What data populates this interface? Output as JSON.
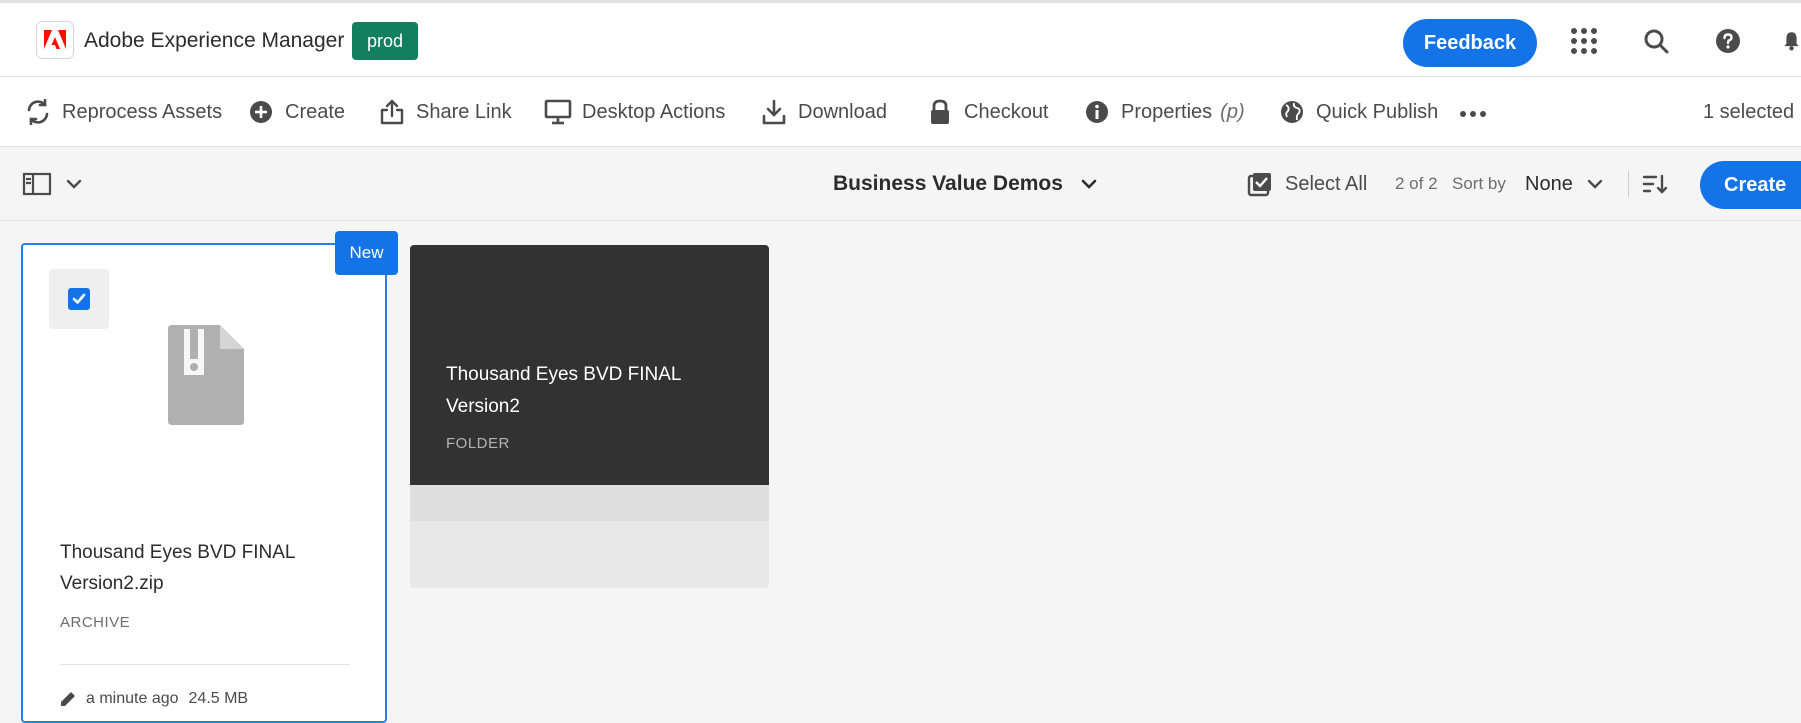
{
  "header": {
    "app_title": "Adobe Experience Manager",
    "env_badge": "prod",
    "feedback_label": "Feedback",
    "icons": [
      "adobe-logo-icon",
      "apps-grid-icon",
      "search-icon",
      "help-icon",
      "bell-icon"
    ],
    "brand_color": "#fa0f00",
    "env_color": "#12805c",
    "accent_color": "#1473e6"
  },
  "actions": {
    "reprocess": "Reprocess Assets",
    "create": "Create",
    "share_link": "Share Link",
    "desktop_actions": "Desktop Actions",
    "download": "Download",
    "checkout": "Checkout",
    "properties": "Properties",
    "properties_shortcut": "(p)",
    "quick_publish": "Quick Publish",
    "selected_count": "1 selected ("
  },
  "context": {
    "folder_title": "Business Value Demos",
    "select_all": "Select All",
    "count": "2 of 2",
    "sort_by_label": "Sort by",
    "sort_value": "None",
    "create_label": "Create"
  },
  "cards": [
    {
      "badge": "New",
      "title": "Thousand Eyes BVD FINAL Version2.zip",
      "type": "ARCHIVE",
      "modified": "a minute ago",
      "size": "24.5 MB",
      "selected": true
    },
    {
      "title": "Thousand Eyes BVD FINAL Version2",
      "type": "FOLDER"
    }
  ]
}
